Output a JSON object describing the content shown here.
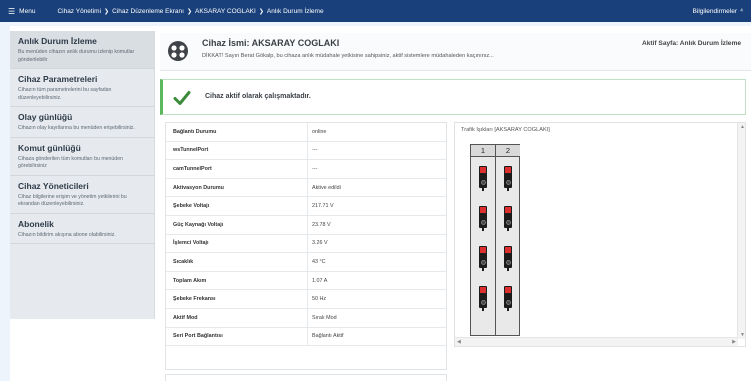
{
  "topbar": {
    "menu_label": "Menu",
    "breadcrumbs": [
      "Cihaz Yönetimi",
      "Cihaz Düzenleme Ekranı",
      "AKSARAY COGLAKI",
      "Anlık Durum İzleme"
    ],
    "notifications_label": "Bilgilendirmeler"
  },
  "sidebar": {
    "items": [
      {
        "title": "Anlık Durum İzleme",
        "desc": "Bu menüden cihazın anlık durumu izlenip komutlar gönderilebilir"
      },
      {
        "title": "Cihaz Parametreleri",
        "desc": "Cihazın tüm parametrelerini bu sayfadan düzenleyebilirsiniz."
      },
      {
        "title": "Olay günlüğü",
        "desc": "Cihazın olay kayıtlarına bu menüden erişebilirsiniz."
      },
      {
        "title": "Komut günlüğü",
        "desc": "Cihaza gönderilen tüm komutları bu menüden görebilirsiniz"
      },
      {
        "title": "Cihaz Yöneticileri",
        "desc": "Cihaz bilgilerine erişim ve yönetim yetkilerini bu ekrandan düzenleyebilirsiniz."
      },
      {
        "title": "Abonelik",
        "desc": "Cihazın bildirim akışına abone olabilirsiniz."
      }
    ]
  },
  "device": {
    "name": "Cihaz İsmi: AKSARAY COGLAKI",
    "warning": "DİKKAT! Sayın Berat Gökalp, bu cihaza anlık müdahale yetkisine sahipsiniz, aktif sistemlere müdahaleden kaçınınız...",
    "active_page": "Aktif Sayfa: Anlık Durum İzleme"
  },
  "status": {
    "message": "Cihaz aktif olarak çalışmaktadır.",
    "color": "#3a8a3a"
  },
  "info_rows": [
    {
      "key": "Bağlantı Durumu",
      "value": "online"
    },
    {
      "key": "wsTunnelPort",
      "value": "---"
    },
    {
      "key": "camTunnelPort",
      "value": "---"
    },
    {
      "key": "Aktivasyon Durumu",
      "value": "Aktive edildi"
    },
    {
      "key": "Şebeke Voltajı",
      "value": "217.71 V"
    },
    {
      "key": "Güç Kaynağı Voltajı",
      "value": "23.78 V"
    },
    {
      "key": "İşlemci Voltajı",
      "value": "3.26 V"
    },
    {
      "key": "Sıcaklık",
      "value": "43 °C"
    },
    {
      "key": "Toplam Akım",
      "value": "1.07 A"
    },
    {
      "key": "Şebeke Frekansı",
      "value": "50 Hz"
    },
    {
      "key": "Aktif Mod",
      "value": "Sıralı Mod"
    },
    {
      "key": "Seri Port Bağlantısı",
      "value": "Bağlantı Aktif"
    }
  ],
  "traffic": {
    "title": "Trafik Işıkları [AKSARAY COGLAKI]",
    "columns": [
      "1",
      "2"
    ],
    "signals_per_column": 4,
    "active_color": "#d9302f"
  }
}
